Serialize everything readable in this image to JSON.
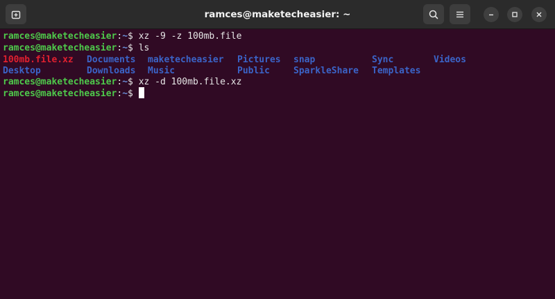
{
  "window": {
    "title": "ramces@maketecheasier: ~",
    "colors": {
      "titlebar_bg": "#2b2b2b",
      "terminal_bg": "#300a24",
      "prompt_user": "#4ec94b",
      "prompt_path": "#6a8fd8",
      "directory": "#3b64c8",
      "archive": "#e0202f",
      "text": "#e6e6e6"
    }
  },
  "toolbar": {
    "new_tab_icon": "new-tab-icon",
    "search_icon": "search-icon",
    "menu_icon": "hamburger-menu-icon",
    "minimize_icon": "minimize-icon",
    "maximize_icon": "maximize-icon",
    "close_icon": "close-icon"
  },
  "terminal": {
    "prompt": {
      "user_host": "ramces@maketecheasier",
      "separator": ":",
      "path": "~",
      "symbol": "$"
    },
    "lines": [
      {
        "command": "xz -9 -z 100mb.file"
      },
      {
        "command": "ls"
      },
      {
        "output_row1": [
          "100mb.file.xz",
          "Documents",
          "maketecheasier",
          "Pictures",
          "snap",
          "Sync",
          "Videos"
        ]
      },
      {
        "output_row2": [
          "Desktop",
          "Downloads",
          "Music",
          "Public",
          "SparkleShare",
          "Templates"
        ]
      },
      {
        "command": "xz -d 100mb.file.xz"
      },
      {
        "command": ""
      }
    ]
  }
}
